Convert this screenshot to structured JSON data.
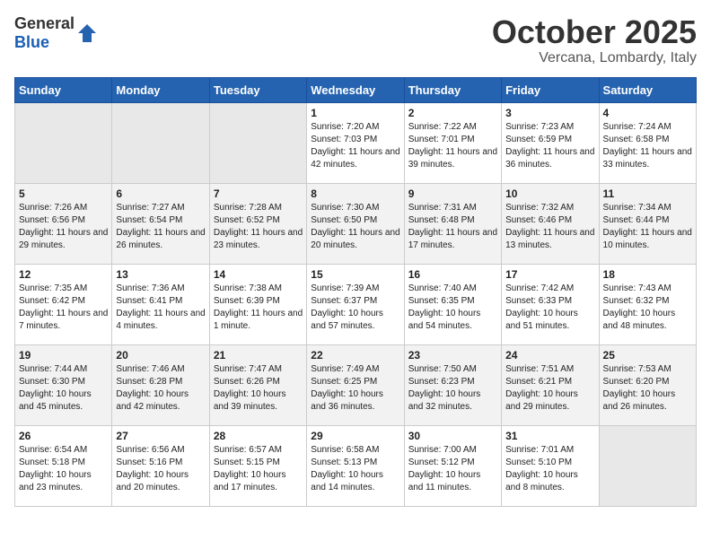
{
  "header": {
    "logo_general": "General",
    "logo_blue": "Blue",
    "month": "October 2025",
    "location": "Vercana, Lombardy, Italy"
  },
  "days_of_week": [
    "Sunday",
    "Monday",
    "Tuesday",
    "Wednesday",
    "Thursday",
    "Friday",
    "Saturday"
  ],
  "weeks": [
    [
      {
        "day": "",
        "empty": true
      },
      {
        "day": "",
        "empty": true
      },
      {
        "day": "",
        "empty": true
      },
      {
        "day": "1",
        "sunrise": "7:20 AM",
        "sunset": "7:03 PM",
        "daylight": "11 hours and 42 minutes."
      },
      {
        "day": "2",
        "sunrise": "7:22 AM",
        "sunset": "7:01 PM",
        "daylight": "11 hours and 39 minutes."
      },
      {
        "day": "3",
        "sunrise": "7:23 AM",
        "sunset": "6:59 PM",
        "daylight": "11 hours and 36 minutes."
      },
      {
        "day": "4",
        "sunrise": "7:24 AM",
        "sunset": "6:58 PM",
        "daylight": "11 hours and 33 minutes."
      }
    ],
    [
      {
        "day": "5",
        "sunrise": "7:26 AM",
        "sunset": "6:56 PM",
        "daylight": "11 hours and 29 minutes."
      },
      {
        "day": "6",
        "sunrise": "7:27 AM",
        "sunset": "6:54 PM",
        "daylight": "11 hours and 26 minutes."
      },
      {
        "day": "7",
        "sunrise": "7:28 AM",
        "sunset": "6:52 PM",
        "daylight": "11 hours and 23 minutes."
      },
      {
        "day": "8",
        "sunrise": "7:30 AM",
        "sunset": "6:50 PM",
        "daylight": "11 hours and 20 minutes."
      },
      {
        "day": "9",
        "sunrise": "7:31 AM",
        "sunset": "6:48 PM",
        "daylight": "11 hours and 17 minutes."
      },
      {
        "day": "10",
        "sunrise": "7:32 AM",
        "sunset": "6:46 PM",
        "daylight": "11 hours and 13 minutes."
      },
      {
        "day": "11",
        "sunrise": "7:34 AM",
        "sunset": "6:44 PM",
        "daylight": "11 hours and 10 minutes."
      }
    ],
    [
      {
        "day": "12",
        "sunrise": "7:35 AM",
        "sunset": "6:42 PM",
        "daylight": "11 hours and 7 minutes."
      },
      {
        "day": "13",
        "sunrise": "7:36 AM",
        "sunset": "6:41 PM",
        "daylight": "11 hours and 4 minutes."
      },
      {
        "day": "14",
        "sunrise": "7:38 AM",
        "sunset": "6:39 PM",
        "daylight": "11 hours and 1 minute."
      },
      {
        "day": "15",
        "sunrise": "7:39 AM",
        "sunset": "6:37 PM",
        "daylight": "10 hours and 57 minutes."
      },
      {
        "day": "16",
        "sunrise": "7:40 AM",
        "sunset": "6:35 PM",
        "daylight": "10 hours and 54 minutes."
      },
      {
        "day": "17",
        "sunrise": "7:42 AM",
        "sunset": "6:33 PM",
        "daylight": "10 hours and 51 minutes."
      },
      {
        "day": "18",
        "sunrise": "7:43 AM",
        "sunset": "6:32 PM",
        "daylight": "10 hours and 48 minutes."
      }
    ],
    [
      {
        "day": "19",
        "sunrise": "7:44 AM",
        "sunset": "6:30 PM",
        "daylight": "10 hours and 45 minutes."
      },
      {
        "day": "20",
        "sunrise": "7:46 AM",
        "sunset": "6:28 PM",
        "daylight": "10 hours and 42 minutes."
      },
      {
        "day": "21",
        "sunrise": "7:47 AM",
        "sunset": "6:26 PM",
        "daylight": "10 hours and 39 minutes."
      },
      {
        "day": "22",
        "sunrise": "7:49 AM",
        "sunset": "6:25 PM",
        "daylight": "10 hours and 36 minutes."
      },
      {
        "day": "23",
        "sunrise": "7:50 AM",
        "sunset": "6:23 PM",
        "daylight": "10 hours and 32 minutes."
      },
      {
        "day": "24",
        "sunrise": "7:51 AM",
        "sunset": "6:21 PM",
        "daylight": "10 hours and 29 minutes."
      },
      {
        "day": "25",
        "sunrise": "7:53 AM",
        "sunset": "6:20 PM",
        "daylight": "10 hours and 26 minutes."
      }
    ],
    [
      {
        "day": "26",
        "sunrise": "6:54 AM",
        "sunset": "5:18 PM",
        "daylight": "10 hours and 23 minutes."
      },
      {
        "day": "27",
        "sunrise": "6:56 AM",
        "sunset": "5:16 PM",
        "daylight": "10 hours and 20 minutes."
      },
      {
        "day": "28",
        "sunrise": "6:57 AM",
        "sunset": "5:15 PM",
        "daylight": "10 hours and 17 minutes."
      },
      {
        "day": "29",
        "sunrise": "6:58 AM",
        "sunset": "5:13 PM",
        "daylight": "10 hours and 14 minutes."
      },
      {
        "day": "30",
        "sunrise": "7:00 AM",
        "sunset": "5:12 PM",
        "daylight": "10 hours and 11 minutes."
      },
      {
        "day": "31",
        "sunrise": "7:01 AM",
        "sunset": "5:10 PM",
        "daylight": "10 hours and 8 minutes."
      },
      {
        "day": "",
        "empty": true
      }
    ]
  ],
  "labels": {
    "sunrise": "Sunrise:",
    "sunset": "Sunset:",
    "daylight": "Daylight:"
  }
}
